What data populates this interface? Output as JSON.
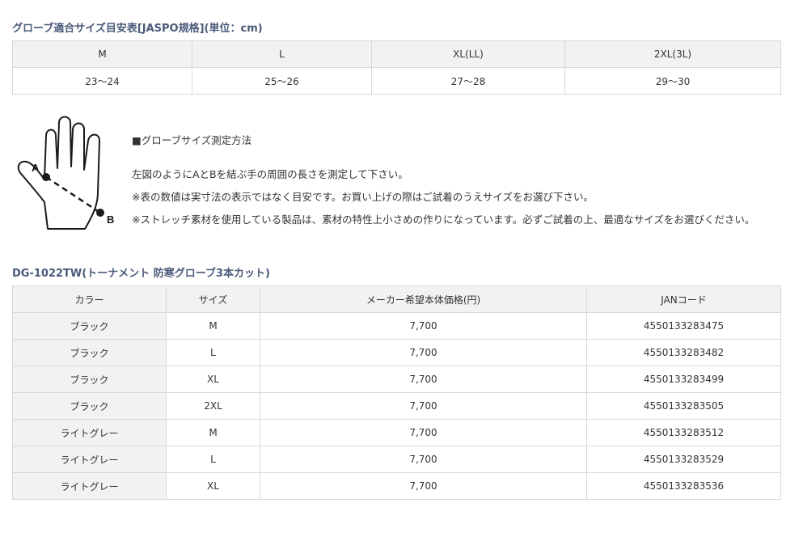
{
  "size_chart": {
    "title": "グローブ適合サイズ目安表[JASPO規格](単位：cm)",
    "headers": [
      "M",
      "L",
      "XL(LL)",
      "2XL(3L)"
    ],
    "values": [
      "23〜24",
      "25〜26",
      "27〜28",
      "29〜30"
    ]
  },
  "measure": {
    "label_a": "A",
    "label_b": "B",
    "heading": "■グローブサイズ測定方法",
    "lines": [
      "左図のようにAとBを結ぶ手の周囲の長さを測定して下さい。",
      "※表の数値は実寸法の表示ではなく目安です。お買い上げの際はご試着のうえサイズをお選び下さい。",
      "※ストレッチ素材を使用している製品は、素材の特性上小さめの作りになっています。必ずご試着の上、最適なサイズをお選びください。"
    ]
  },
  "product": {
    "title": "DG-1022TW(トーナメント 防寒グローブ3本カット)",
    "headers": [
      "カラー",
      "サイズ",
      "メーカー希望本体価格(円)",
      "JANコード"
    ],
    "rows": [
      [
        "ブラック",
        "M",
        "7,700",
        "4550133283475"
      ],
      [
        "ブラック",
        "L",
        "7,700",
        "4550133283482"
      ],
      [
        "ブラック",
        "XL",
        "7,700",
        "4550133283499"
      ],
      [
        "ブラック",
        "2XL",
        "7,700",
        "4550133283505"
      ],
      [
        "ライトグレー",
        "M",
        "7,700",
        "4550133283512"
      ],
      [
        "ライトグレー",
        "L",
        "7,700",
        "4550133283529"
      ],
      [
        "ライトグレー",
        "XL",
        "7,700",
        "4550133283536"
      ]
    ]
  }
}
